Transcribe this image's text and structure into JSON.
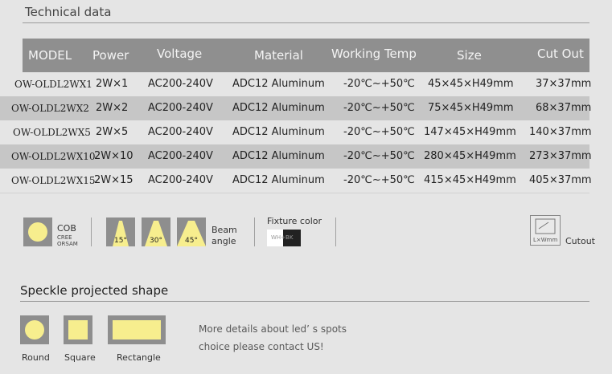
{
  "section_title": "Technical data",
  "table": {
    "headers": [
      "MODEL",
      "Power",
      "Voltage",
      "Material",
      "Working Temp",
      "Size",
      "Cut Out"
    ],
    "rows": [
      [
        "OW-OLDL2WX1",
        "2W×1",
        "AC200-240V",
        "ADC12 Aluminum",
        "-20℃~+50℃",
        "45×45×H49mm",
        "37×37mm"
      ],
      [
        "OW-OLDL2WX2",
        "2W×2",
        "AC200-240V",
        "ADC12 Aluminum",
        "-20℃~+50℃",
        "75×45×H49mm",
        "68×37mm"
      ],
      [
        "OW-OLDL2WX5",
        "2W×5",
        "AC200-240V",
        "ADC12 Aluminum",
        "-20℃~+50℃",
        "147×45×H49mm",
        "140×37mm"
      ],
      [
        "OW-OLDL2WX10",
        "2W×10",
        "AC200-240V",
        "ADC12 Aluminum",
        "-20℃~+50℃",
        "280×45×H49mm",
        "273×37mm"
      ],
      [
        "OW-OLDL2WX15",
        "2W×15",
        "AC200-240V",
        "ADC12 Aluminum",
        "-20℃~+50℃",
        "415×45×H49mm",
        "405×37mm"
      ]
    ]
  },
  "features": {
    "cob": {
      "label": "COB",
      "sub1": "CREE",
      "sub2": "ORSAM"
    },
    "beam": {
      "angles": [
        "15°",
        "30°",
        "45°"
      ],
      "label1": "Beam",
      "label2": "angle"
    },
    "fixture": {
      "label": "Fixture color",
      "swatch_text": "WH+BK"
    },
    "cutout": {
      "icon_text": "L×Wmm",
      "label": "Cutout"
    }
  },
  "speckle": {
    "title": "Speckle projected shape",
    "shapes": [
      "Round",
      "Square",
      "Rectangle"
    ],
    "info_line1": "More details about led’ s spots",
    "info_line2": "choice please contact US!"
  },
  "colors": {
    "header_bg": "#8f8f8f",
    "alt_row": "#c6c6c6",
    "spot_fill": "#f7ee8e",
    "icon_bg": "#8e8e8e"
  }
}
